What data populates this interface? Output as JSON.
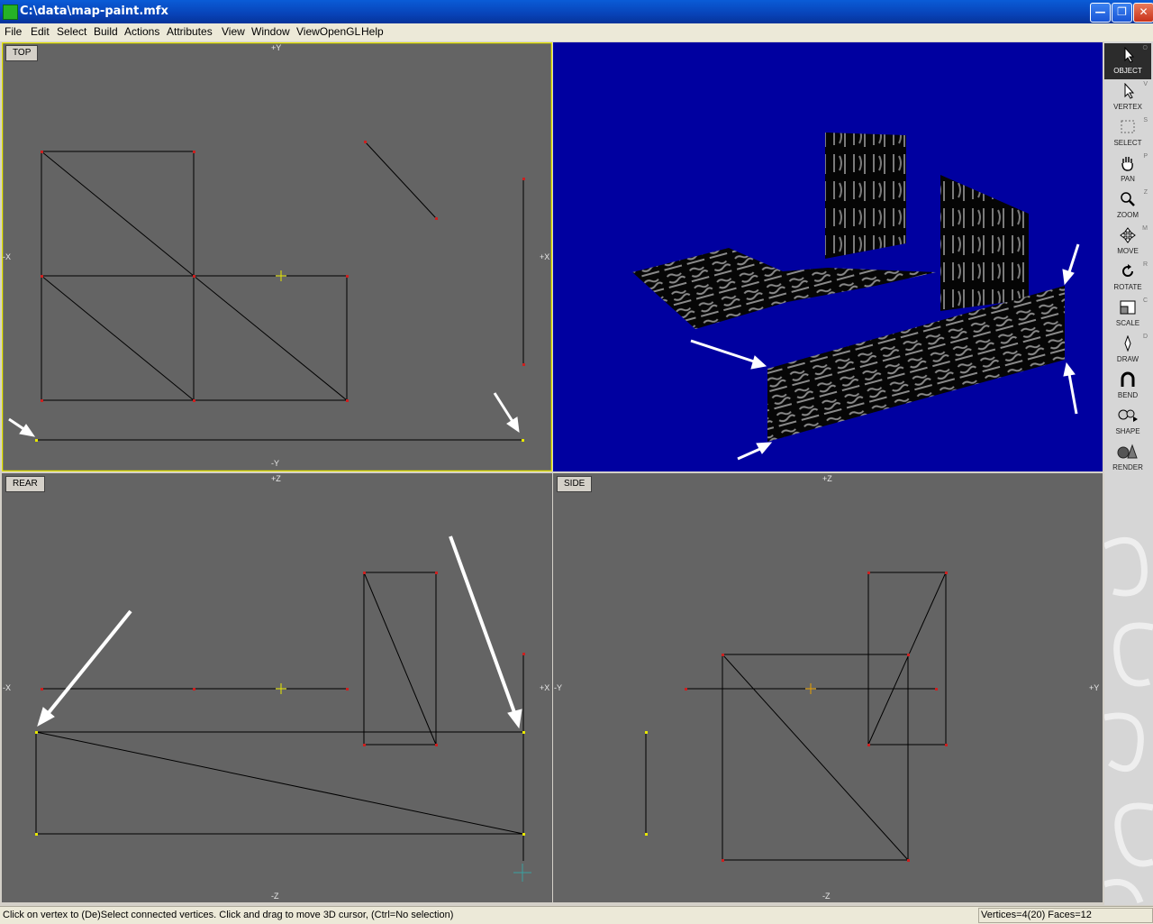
{
  "window": {
    "title": "C:\\data\\map-paint.mfx",
    "buttons": [
      "minimize",
      "maximize",
      "close"
    ]
  },
  "menu": [
    "File",
    "Edit",
    "Select",
    "Build",
    "Actions",
    "Attributes",
    "View",
    "Window",
    "ViewOpenGL",
    "Help"
  ],
  "viewports": {
    "top": {
      "label": "TOP",
      "axis_top": "+Y",
      "axis_bottom": "-Y",
      "axis_left": "-X",
      "axis_right": "+X"
    },
    "rear": {
      "label": "REAR",
      "axis_top": "+Z",
      "axis_bottom": "-Z",
      "axis_left": "-X",
      "axis_right": "+X"
    },
    "side": {
      "label": "SIDE",
      "axis_top": "+Z",
      "axis_bottom": "-Z",
      "axis_left": "-Y",
      "axis_right": "+Y"
    },
    "perspective": {
      "background": "#0000a0"
    }
  },
  "tools": [
    {
      "label": "OBJECT",
      "shortcut": "O",
      "icon": "arrow-cursor-icon",
      "active": true
    },
    {
      "label": "VERTEX",
      "shortcut": "V",
      "icon": "vertex-cursor-icon",
      "active": false
    },
    {
      "label": "SELECT",
      "shortcut": "S",
      "icon": "select-rect-icon",
      "active": false
    },
    {
      "label": "PAN",
      "shortcut": "P",
      "icon": "hand-icon",
      "active": false
    },
    {
      "label": "ZOOM",
      "shortcut": "Z",
      "icon": "magnifier-icon",
      "active": false
    },
    {
      "label": "MOVE",
      "shortcut": "M",
      "icon": "move-arrows-icon",
      "active": false
    },
    {
      "label": "ROTATE",
      "shortcut": "R",
      "icon": "rotate-icon",
      "active": false
    },
    {
      "label": "SCALE",
      "shortcut": "C",
      "icon": "scale-icon",
      "active": false
    },
    {
      "label": "DRAW",
      "shortcut": "D",
      "icon": "pen-icon",
      "active": false
    },
    {
      "label": "BEND",
      "shortcut": "",
      "icon": "bend-icon",
      "active": false
    },
    {
      "label": "SHAPE",
      "shortcut": "",
      "icon": "shapes-icon",
      "active": false
    },
    {
      "label": "RENDER",
      "shortcut": "",
      "icon": "render-spheres-icon",
      "active": false
    }
  ],
  "status": {
    "message": "Click on vertex to (De)Select connected vertices. Click and drag to move 3D cursor, (Ctrl=No selection)",
    "counts": "Vertices=4(20) Faces=12"
  },
  "colors": {
    "viewport_bg": "#646464",
    "active_border": "#e8e800",
    "wire": "#000000",
    "vertex": "#cc2020",
    "selected_vertex": "#e8e800",
    "annotation_arrow": "#ffffff",
    "perspective_bg": "#0000a0"
  }
}
